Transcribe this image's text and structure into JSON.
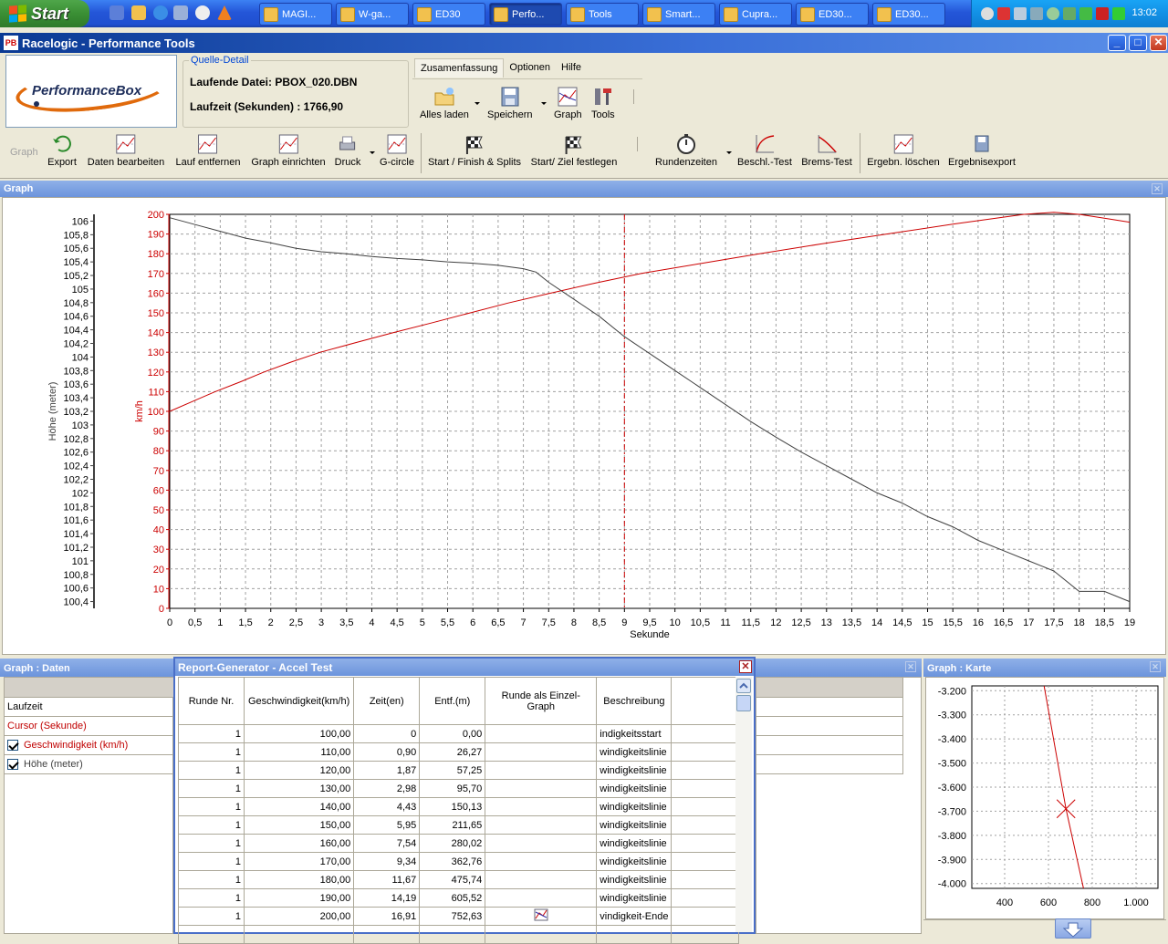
{
  "taskbar": {
    "start_label": "Start",
    "tasks": [
      {
        "label": "MAGI..."
      },
      {
        "label": "W-ga..."
      },
      {
        "label": "ED30"
      },
      {
        "label": "Perfo..."
      },
      {
        "label": "Tools"
      },
      {
        "label": "Smart..."
      },
      {
        "label": "Cupra..."
      },
      {
        "label": "ED30..."
      },
      {
        "label": "ED30..."
      }
    ],
    "clock": "13:02"
  },
  "window": {
    "title": "Racelogic - Performance Tools",
    "minimize": "_",
    "maximize": "□",
    "close": "✕"
  },
  "logo": {
    "text": "PerformanceBox"
  },
  "source": {
    "legend": "Quelle-Detail",
    "file_label": "Laufende Datei: PBOX_020.DBN",
    "runtime_label": "Laufzeit (Sekunden) : 1766,90"
  },
  "menu": {
    "items": [
      "Zusamenfassung",
      "Optionen",
      "Hilfe"
    ]
  },
  "top_toolbar": {
    "items": [
      "Alles laden",
      "Speichern",
      "Graph",
      "Tools"
    ]
  },
  "graph_toolbar": {
    "group_label": "Graph",
    "items": [
      "Export",
      "Daten bearbeiten",
      "Lauf entfernen",
      "Graph einrichten",
      "Druck",
      "G-circle",
      "Start / Finish & Splits",
      "Start/ Ziel festlegen",
      "Rundenzeiten",
      "Beschl.-Test",
      "Brems-Test",
      "Ergebn. löschen",
      "Ergebnisexport"
    ]
  },
  "graph_panel": {
    "title": "Graph",
    "close": "✕"
  },
  "chart_data": {
    "type": "line",
    "xlabel": "Sekunde",
    "ylabel_left": "Höhe (meter)",
    "ylabel_right": "km/h",
    "x_ticks": [
      "0",
      "0,5",
      "1",
      "1,5",
      "2",
      "2,5",
      "3",
      "3,5",
      "4",
      "4,5",
      "5",
      "5,5",
      "6",
      "6,5",
      "7",
      "7,5",
      "8",
      "8,5",
      "9",
      "9,5",
      "10",
      "10,5",
      "11",
      "11,5",
      "12",
      "12,5",
      "13",
      "13,5",
      "14",
      "14,5",
      "15",
      "15,5",
      "16",
      "16,5",
      "17",
      "17,5",
      "18",
      "18,5",
      "19"
    ],
    "speed_ticks": [
      "0",
      "10",
      "20",
      "30",
      "40",
      "50",
      "60",
      "70",
      "80",
      "90",
      "100",
      "110",
      "120",
      "130",
      "140",
      "150",
      "160",
      "170",
      "180",
      "190",
      "200"
    ],
    "height_ticks": [
      "100,4",
      "100,6",
      "100,8",
      "101",
      "101,2",
      "101,4",
      "101,6",
      "101,8",
      "102",
      "102,2",
      "102,4",
      "102,6",
      "102,8",
      "103",
      "103,2",
      "103,4",
      "103,6",
      "103,8",
      "104",
      "104,2",
      "104,4",
      "104,6",
      "104,8",
      "105",
      "105,2",
      "105,4",
      "105,6",
      "105,8",
      "106"
    ],
    "xlim": [
      0,
      19
    ],
    "speed_ylim": [
      0,
      200
    ],
    "height_ylim": [
      100.3,
      106.1
    ],
    "cursor_x": 9,
    "grid": true,
    "colors": {
      "speed": "#cc0000",
      "height": "#404040",
      "cursor": "#cc0000",
      "grid": "#a0a0a0"
    },
    "series": [
      {
        "name": "Geschwindigkeit (km/h)",
        "axis": "speed",
        "x": [
          0,
          0.45,
          0.9,
          1.4,
          1.87,
          2.4,
          2.98,
          3.7,
          4.43,
          5.2,
          5.95,
          6.7,
          7.54,
          8.4,
          9.34,
          10.5,
          11.67,
          12.9,
          14.19,
          15.5,
          16.91,
          17.5,
          18,
          18.5,
          19
        ],
        "y": [
          100,
          105,
          110,
          115,
          120,
          125,
          130,
          135,
          140,
          145,
          150,
          155,
          160,
          165,
          170,
          175,
          180,
          185,
          190,
          195,
          200,
          201,
          200,
          198,
          196
        ]
      },
      {
        "name": "Höhe (meter)",
        "axis": "height",
        "x": [
          0,
          0.5,
          1,
          1.5,
          2,
          2.5,
          3,
          3.5,
          4,
          4.5,
          5,
          5.5,
          6,
          6.5,
          7,
          7.25,
          7.5,
          8,
          8.5,
          9,
          9.5,
          10,
          10.5,
          11,
          11.5,
          12,
          12.5,
          13,
          13.5,
          14,
          14.5,
          15,
          15.5,
          16,
          16.5,
          17,
          17.5,
          18,
          18.5,
          19
        ],
        "y": [
          106.05,
          105.95,
          105.85,
          105.75,
          105.68,
          105.6,
          105.55,
          105.52,
          105.48,
          105.45,
          105.43,
          105.4,
          105.38,
          105.35,
          105.3,
          105.25,
          105.1,
          104.85,
          104.6,
          104.3,
          104.05,
          103.8,
          103.55,
          103.3,
          103.05,
          102.82,
          102.6,
          102.4,
          102.2,
          102.0,
          101.85,
          101.65,
          101.5,
          101.3,
          101.15,
          101.0,
          100.85,
          100.55,
          100.55,
          100.4
        ]
      }
    ]
  },
  "data_panel": {
    "title": "Graph : Daten",
    "rows": [
      "Laufzeit",
      "Cursor (Sekunde)",
      "Geschwindigkeit (km/h)",
      "Höhe (meter)"
    ],
    "close": "✕"
  },
  "report": {
    "title": "Report-Generator - Accel Test",
    "close": "✕",
    "columns": [
      "Runde Nr.",
      "Geschwindigkeit(km/h)",
      "Zeit(en)",
      "Entf.(m)",
      "Runde als Einzel-Graph",
      "Beschreibung"
    ],
    "rows": [
      [
        "1",
        "100,00",
        "0",
        "0,00",
        "",
        "indigkeitsstart"
      ],
      [
        "1",
        "110,00",
        "0,90",
        "26,27",
        "",
        "windigkeitslinie"
      ],
      [
        "1",
        "120,00",
        "1,87",
        "57,25",
        "",
        "windigkeitslinie"
      ],
      [
        "1",
        "130,00",
        "2,98",
        "95,70",
        "",
        "windigkeitslinie"
      ],
      [
        "1",
        "140,00",
        "4,43",
        "150,13",
        "",
        "windigkeitslinie"
      ],
      [
        "1",
        "150,00",
        "5,95",
        "211,65",
        "",
        "windigkeitslinie"
      ],
      [
        "1",
        "160,00",
        "7,54",
        "280,02",
        "",
        "windigkeitslinie"
      ],
      [
        "1",
        "170,00",
        "9,34",
        "362,76",
        "",
        "windigkeitslinie"
      ],
      [
        "1",
        "180,00",
        "11,67",
        "475,74",
        "",
        "windigkeitslinie"
      ],
      [
        "1",
        "190,00",
        "14,19",
        "605,52",
        "",
        "windigkeitslinie"
      ],
      [
        "1",
        "200,00",
        "16,91",
        "752,63",
        "graph-icon",
        "vindigkeit-Ende"
      ]
    ]
  },
  "map_panel": {
    "title": "Graph : Karte",
    "close": "✕",
    "y_ticks": [
      "-3.200",
      "-3.300",
      "-3.400",
      "-3.500",
      "-3.600",
      "-3.700",
      "-3.800",
      "-3.900",
      "-4.000"
    ],
    "x_ticks": [
      "400",
      "600",
      "800",
      "1.000"
    ],
    "xlim": [
      250,
      1100
    ],
    "ylim": [
      -4020,
      -3180
    ],
    "track": {
      "x": [
        580,
        680,
        760
      ],
      "y": [
        -3180,
        -3690,
        -4020
      ]
    },
    "marker": {
      "x": 680,
      "y": -3690
    }
  }
}
